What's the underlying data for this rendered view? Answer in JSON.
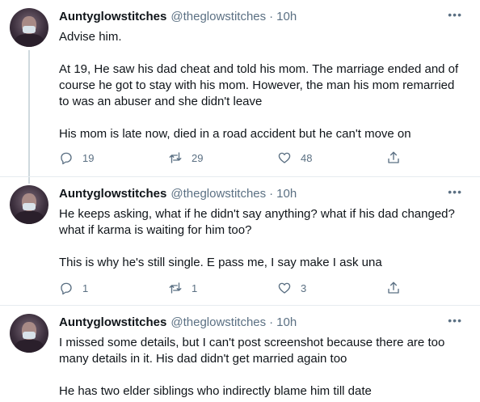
{
  "tweets": [
    {
      "name": "Auntyglowstitches",
      "handle": "@theglowstitches",
      "separator": "·",
      "time": "10h",
      "more": "•••",
      "text": "Advise him.\n\nAt 19, He saw his dad cheat and told his mom. The marriage ended and of course he got to stay with his mom. However, the man his mom remarried to was an abuser and she didn't leave\n\nHis mom is late now, died in a road accident but he can't move on",
      "replies": "19",
      "retweets": "29",
      "likes": "48"
    },
    {
      "name": "Auntyglowstitches",
      "handle": "@theglowstitches",
      "separator": "·",
      "time": "10h",
      "more": "•••",
      "text": "He keeps asking, what if he didn't say anything? what if his dad changed? what if karma is waiting for him too?\n\nThis is why he's still single. E pass me, I say make I ask una",
      "replies": "1",
      "retweets": "1",
      "likes": "3"
    },
    {
      "name": "Auntyglowstitches",
      "handle": "@theglowstitches",
      "separator": "·",
      "time": "10h",
      "more": "•••",
      "text": "I missed some details, but I can't post screenshot because there are too many details in it.  His dad didn't get married again too\n\nHe has two elder siblings who indirectly blame him till date"
    }
  ],
  "colors": {
    "text": "#0f1419",
    "secondary": "#5b7083",
    "divider": "#e6ecf0"
  },
  "icons": [
    "reply-icon",
    "retweet-icon",
    "like-icon",
    "share-icon",
    "more-icon"
  ]
}
